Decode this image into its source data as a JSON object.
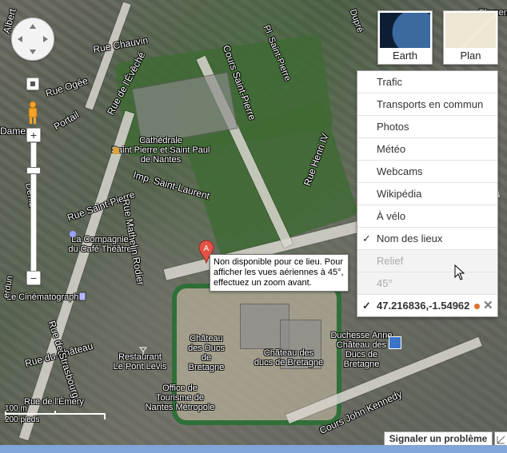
{
  "map_type_buttons": {
    "earth": "Earth",
    "plan": "Plan"
  },
  "layers_menu": {
    "items": [
      {
        "label": "Trafic",
        "checked": false,
        "enabled": true
      },
      {
        "label": "Transports en commun",
        "checked": false,
        "enabled": true
      },
      {
        "label": "Photos",
        "checked": false,
        "enabled": true
      },
      {
        "label": "Météo",
        "checked": false,
        "enabled": true
      },
      {
        "label": "Webcams",
        "checked": false,
        "enabled": true
      },
      {
        "label": "Wikipédia",
        "checked": false,
        "enabled": true
      },
      {
        "label": "À vélo",
        "checked": false,
        "enabled": true
      },
      {
        "label": "Nom des lieux",
        "checked": true,
        "enabled": true
      },
      {
        "label": "Relief",
        "checked": false,
        "enabled": false
      },
      {
        "label": "45°",
        "checked": false,
        "enabled": false
      }
    ],
    "coordinates": "47.216836,-1.54962",
    "check_glyph": "✓",
    "close_glyph": "✕"
  },
  "marker": {
    "letter": "A",
    "color": "#e35345"
  },
  "tooltip": {
    "text": "Non disponible pour ce lieu. Pour afficher les vues aériennes à 45°, effectuez un zoom avant."
  },
  "map_labels": {
    "rue_albert": "Albert",
    "rue_chauvin": "Rue Chauvin",
    "rue_ogee": "Rue Ogée",
    "rue_portail": "Portail",
    "dame": "Dame",
    "rue_eveche": "Rue de l'Évêché",
    "cours_saint_pierre": "Cours Saint-Pierre",
    "pl_st_pierre": "Pl. Saint-Pierre",
    "rue_henri": "Rue Henri IV",
    "cathedrale": "Cathédrale\nSaint Pierre et Saint Paul\nde Nantes",
    "imp_saint_laurent": "Imp. Saint-Laurent",
    "rue_saint_pierre": "Rue Saint-Pierre",
    "denis": "Denis",
    "compagnie": "La Compagnie\ndu Café Théâtre",
    "rue_mathelin": "Rue Mathelin Rodier",
    "cinematographe": "Le Cinématographe",
    "rue_chateau": "Rue du Château",
    "restaurant": "Restaurant\nLe Pont Levis",
    "chateau_1": "Château\ndes Ducs de\nBretagne",
    "chateau_2": "Château des\nducs de Bretagne",
    "duchesse": "Duchesse Anne\nChâteau des\nDucs de Bretagne",
    "office": "Office de\nTourisme de\nNantes Métropole",
    "rue_strasbourg": "Rue de Strasbourg",
    "rue_emery": "Rue de l'Émery",
    "cours_kennedy": "Cours John Kennedy",
    "duquesne": "Dupré",
    "erdun": "erdun",
    "clemenceau": "Clemen"
  },
  "scale": {
    "metric": "100 m",
    "imperial": "200 pieds"
  },
  "report_problem": "Signaler un problème"
}
